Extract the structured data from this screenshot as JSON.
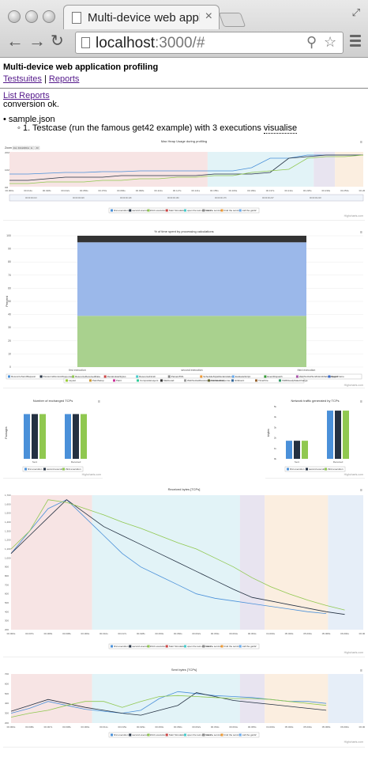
{
  "browser": {
    "tab_title": "Multi-device web application profiling",
    "url_host": "localhost",
    "url_rest": ":3000/#"
  },
  "page": {
    "title": "Multi-device web application profiling",
    "nav_testsuites": "Testsuites",
    "nav_separator": "|",
    "nav_reports": "Reports",
    "list_reports": "List Reports",
    "status": "conversion ok.",
    "file": "sample.json",
    "testcase_text": "1. Testcase (run the famous get42 example) with 3 executions",
    "visualise": "visualise"
  },
  "legend_full": [
    "first execution",
    "second execution",
    "third execution",
    "Start Simulation",
    "open the test app view",
    "find the service",
    "bind the service",
    "call the get42"
  ],
  "legend_short": [
    "first execution",
    "second execution",
    "third execution"
  ],
  "credits": "Highcharts.com",
  "colors": {
    "first": "#4a90d9",
    "second": "#243142",
    "third": "#90c850",
    "band_red": "#f7e4e4",
    "band_cyan": "#e2f3f7",
    "band_purple": "#e8e4f0",
    "band_orange": "#fbeee0",
    "band_blue": "#e6eef8"
  },
  "chart_data": [
    {
      "type": "line",
      "title": "Max Heap Usage during profiling",
      "ylabels": [
        "20M",
        "10M",
        "0M"
      ],
      "zoom_label": "Zoom",
      "zoom_buttons": [
        "1ms",
        "10ms",
        "100ms",
        "1s",
        "All"
      ],
      "x_ticks": [
        "00.000s",
        "00.014s",
        "00.028s",
        "00.042s",
        "00.056s",
        "00.070s",
        "00.084s",
        "00.098s",
        "00.113s",
        "00.127s",
        "00.141s",
        "00.155s",
        "00.169s",
        "00.183s",
        "00.197s",
        "00.211s",
        "00.225s",
        "00.239s",
        "00.253s",
        "00.267s"
      ],
      "navigator_ticks": [
        "00:00:00.013",
        "00:00:00.029",
        "00:00:00.118",
        "00:00:00.160",
        "00:00:00.176",
        "00:00:00.207",
        "00:00:00.218"
      ],
      "series": [
        {
          "name": "first execution",
          "values": [
            8,
            8,
            8.5,
            9,
            9,
            9.5,
            9.5,
            10,
            10,
            10,
            10,
            10,
            10,
            12,
            18,
            18,
            20,
            20,
            20,
            20
          ]
        },
        {
          "name": "second execution",
          "values": [
            4,
            4,
            5,
            6,
            6,
            6,
            7,
            7,
            7,
            7,
            7,
            8,
            8,
            8,
            9,
            18,
            19,
            20,
            20,
            20
          ]
        },
        {
          "name": "third execution",
          "values": [
            2,
            2,
            3,
            3,
            3,
            4,
            4,
            5,
            5,
            6,
            6,
            7,
            7,
            9,
            10,
            11,
            18,
            19,
            19,
            20
          ]
        }
      ]
    },
    {
      "type": "bar",
      "title": "% of time spent by processing calculations",
      "ylabel": "Percent",
      "y_ticks": [
        "100",
        "90",
        "80",
        "70",
        "60",
        "50",
        "40",
        "30",
        "20",
        "10",
        "0"
      ],
      "categories": [
        "first execution",
        "second execution",
        "third execution"
      ],
      "stack_layers": [
        {
          "name": "ResourceSendRequest",
          "value": 39
        },
        {
          "name": "GCEvent",
          "value": 56
        },
        {
          "name": "other",
          "value": 5
        }
      ],
      "legend": [
        "ResourceSendRequest",
        "ResourceReceiveResponse",
        "ResourceReceivedData",
        "RecalculateStyles",
        "ResourceFinish",
        "ParseHTML",
        "ScheduleStyleRecalculation",
        "EvaluateScript",
        "EventDispatch",
        "WebSocketSendHandshakeRequest",
        "BeginFrame",
        "Layout",
        "PaintSetup",
        "Paint",
        "CompositeLayers",
        "MarkLoad",
        "WebSocketReceiveHandshakeResponse",
        "FunctionCall",
        "GCEvent",
        "TimerFire",
        "XHRReadyStateChange"
      ]
    },
    {
      "type": "bar",
      "title": "Number of exchanged TCPs",
      "ylabel": "Packages",
      "categories": [
        "Sent",
        "Received"
      ],
      "series": [
        {
          "name": "first execution",
          "values": [
            6,
            6
          ]
        },
        {
          "name": "second execution",
          "values": [
            6,
            6
          ]
        },
        {
          "name": "third execution",
          "values": [
            6,
            6
          ]
        }
      ]
    },
    {
      "type": "bar",
      "title": "Network traffic generated by TCPs",
      "ylabel": "kbytes",
      "y_ticks": [
        "5k",
        "4k",
        "3k",
        "2k",
        "1k",
        "0k"
      ],
      "categories": [
        "Sent",
        "Received"
      ],
      "series": [
        {
          "name": "first execution",
          "values": [
            1.8,
            4.8
          ]
        },
        {
          "name": "second execution",
          "values": [
            1.8,
            4.8
          ]
        },
        {
          "name": "third execution",
          "values": [
            1.8,
            4.8
          ]
        }
      ]
    },
    {
      "type": "line",
      "title": "Received bytes [TCPs]",
      "y_ticks": [
        "1,700",
        "1,600",
        "1,500",
        "1,400",
        "1,300",
        "1,200",
        "1,100",
        "1,000",
        "900",
        "800",
        "700",
        "600",
        "500",
        "400",
        "300",
        "200"
      ],
      "x_ticks": [
        "00.000s",
        "00.007s",
        "00.008s",
        "00.008s",
        "00.009s",
        "00.010s",
        "00.017s",
        "00.028s",
        "00.060s",
        "00.060s",
        "00.062s",
        "00.063s",
        "00.064s",
        "00.064s",
        "04.000s",
        "05.000s",
        "05.004s",
        "05.068s",
        "06.000s",
        "06.000s"
      ],
      "series": [
        {
          "name": "first execution",
          "values": [
            1050,
            1300,
            1550,
            1650,
            1450,
            1250,
            1050,
            900,
            800,
            700,
            600,
            550,
            520,
            490,
            460,
            430,
            400,
            380,
            null,
            null
          ]
        },
        {
          "name": "second execution",
          "values": [
            1050,
            1250,
            1450,
            1650,
            1500,
            1350,
            1250,
            1150,
            1050,
            950,
            850,
            750,
            650,
            560,
            520,
            480,
            440,
            400,
            370,
            null
          ]
        },
        {
          "name": "third execution",
          "values": [
            1100,
            1300,
            1650,
            1620,
            1550,
            1480,
            1400,
            1330,
            1250,
            1170,
            1100,
            1000,
            900,
            780,
            680,
            600,
            530,
            470,
            420,
            null
          ]
        }
      ]
    },
    {
      "type": "line",
      "title": "Sent bytes [TCPs]",
      "y_ticks": [
        "700",
        "600",
        "500",
        "400",
        "300",
        "200"
      ],
      "x_ticks": [
        "00.000s",
        "00.008s",
        "00.007s",
        "00.008s",
        "00.009s",
        "00.011s",
        "00.015s",
        "00.029s",
        "00.060s",
        "00.060s",
        "00.062s",
        "00.064s",
        "00.064s",
        "00.065s",
        "04.000s",
        "05.000s",
        "05.004s",
        "05.068s",
        "06.000s",
        "06.000s"
      ],
      "series": [
        {
          "name": "first execution",
          "values": [
            300,
            350,
            420,
            380,
            340,
            320,
            300,
            330,
            450,
            520,
            500,
            480,
            470,
            460,
            440,
            420,
            420,
            400,
            null,
            null
          ]
        },
        {
          "name": "second execution",
          "values": [
            320,
            380,
            440,
            400,
            360,
            330,
            300,
            280,
            330,
            380,
            510,
            470,
            430,
            410,
            390,
            370,
            350,
            330,
            null,
            null
          ]
        },
        {
          "name": "third execution",
          "values": [
            260,
            300,
            330,
            380,
            420,
            420,
            360,
            420,
            470,
            480,
            470,
            460,
            450,
            450,
            440,
            420,
            400,
            380,
            null,
            null
          ]
        }
      ]
    }
  ]
}
